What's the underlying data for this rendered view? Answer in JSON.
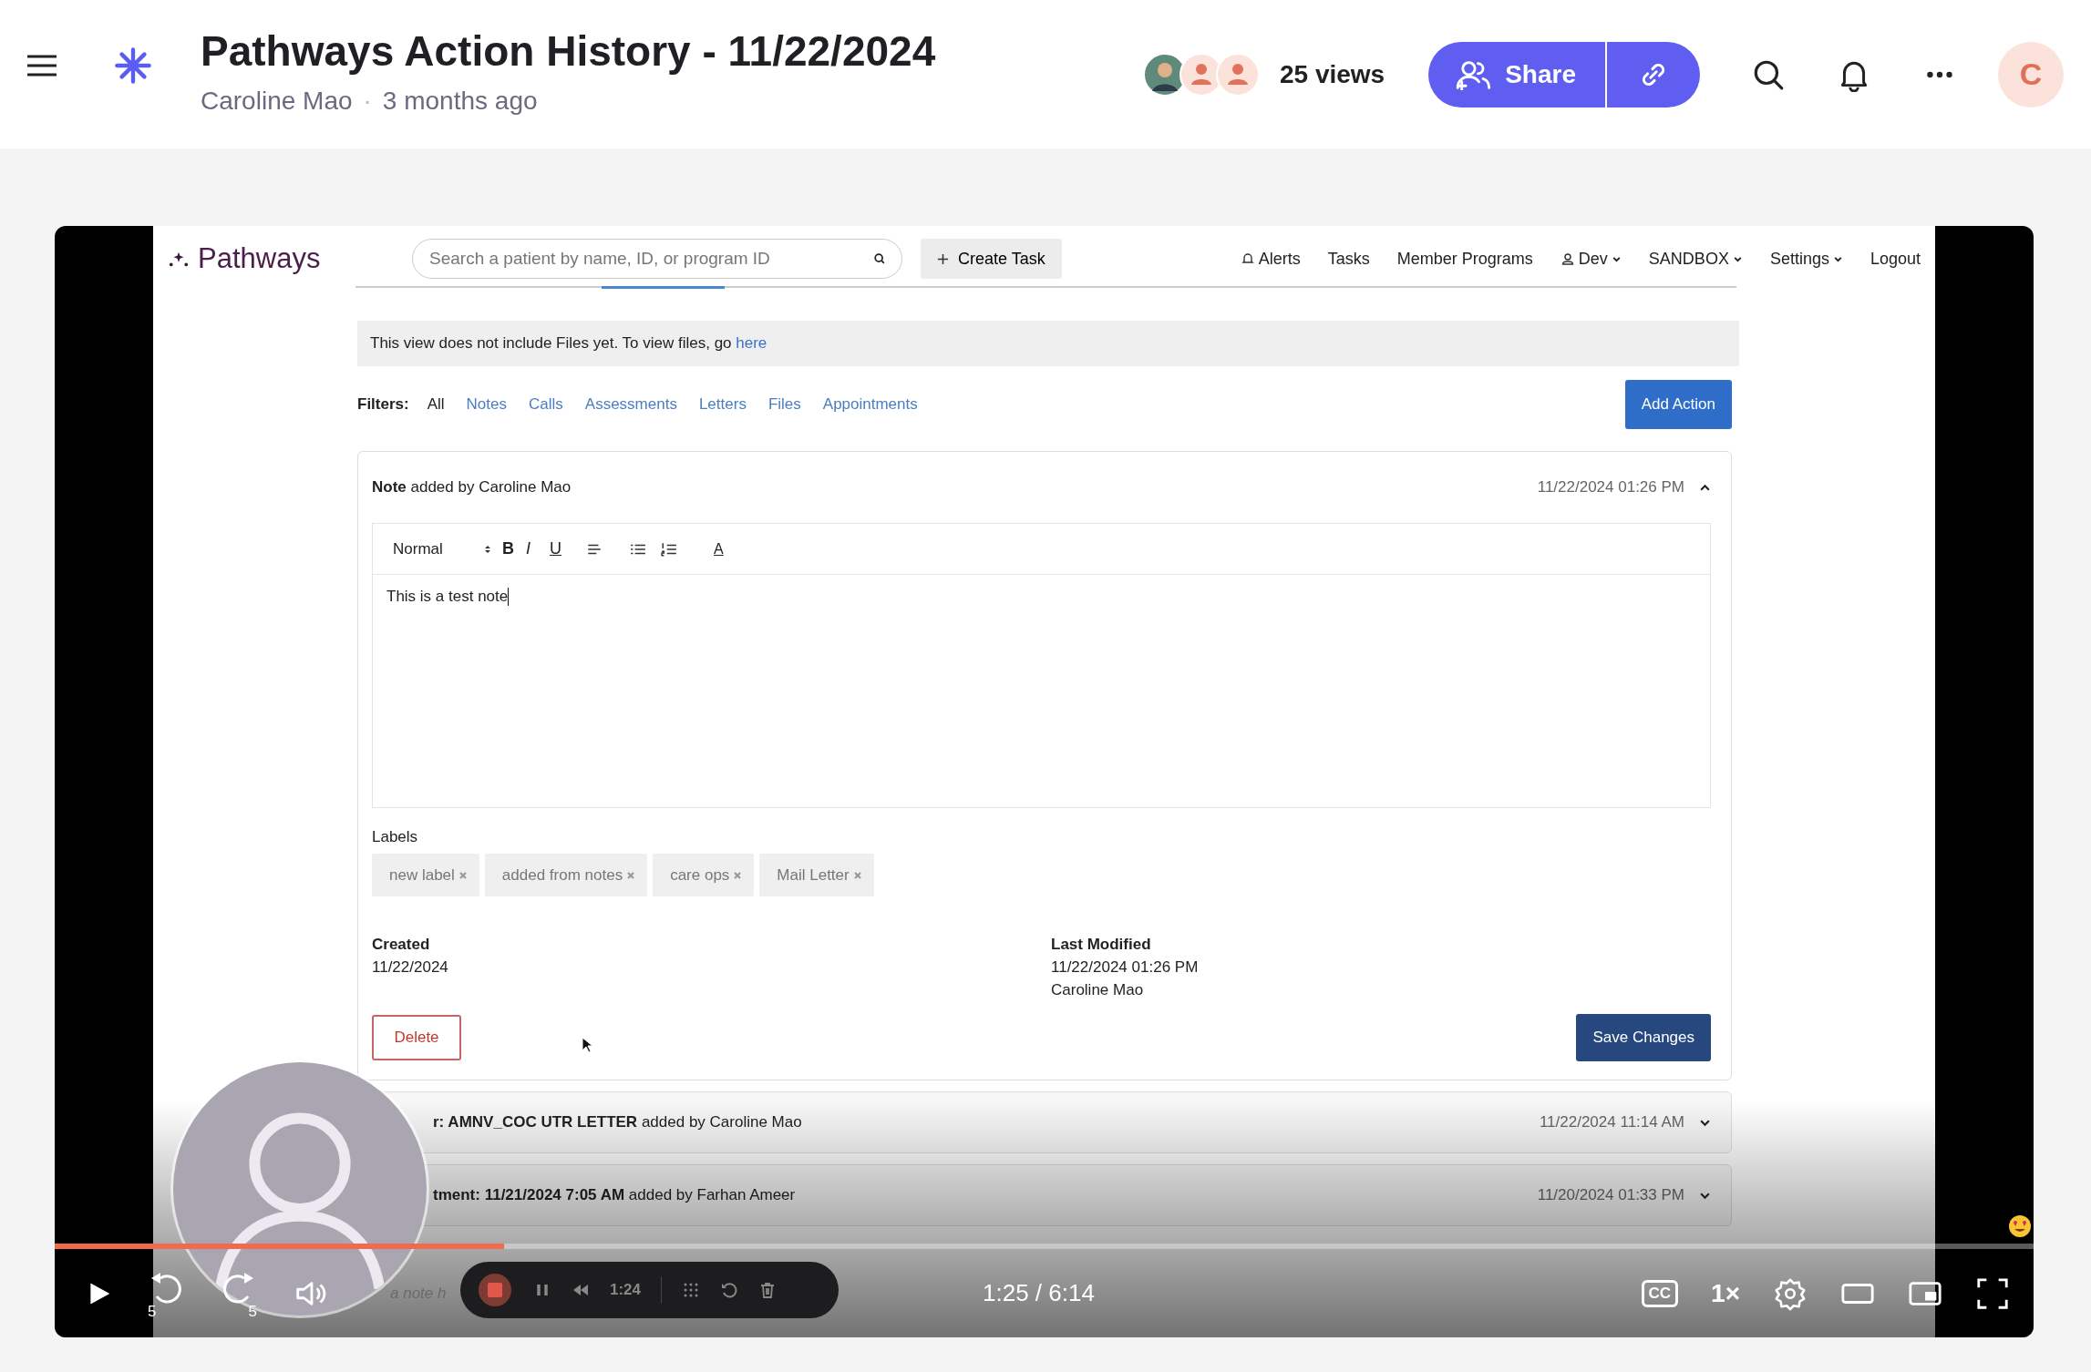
{
  "header": {
    "title": "Pathways Action History - 11/22/2024",
    "author": "Caroline Mao",
    "separator": "·",
    "time_ago": "3 months ago",
    "views": "25 views",
    "share": "Share",
    "user_initial": "C"
  },
  "video": {
    "app": {
      "logo": "Pathways",
      "search": {
        "placeholder": "Search a patient by name, ID, or program ID"
      },
      "create_task": "Create Task",
      "nav": [
        {
          "label": "Alerts",
          "kind": "bell"
        },
        {
          "label": "Tasks",
          "kind": "plain"
        },
        {
          "label": "Member Programs",
          "kind": "plain"
        },
        {
          "label": "Dev",
          "kind": "user"
        },
        {
          "label": "SANDBOX",
          "kind": "dropdown"
        },
        {
          "label": "Settings",
          "kind": "dropdown"
        },
        {
          "label": "Logout",
          "kind": "plain"
        }
      ],
      "banner": {
        "text": "This view does not include Files yet. To view files, go",
        "link": "here"
      },
      "filters": {
        "label": "Filters:",
        "items": [
          {
            "label": "All",
            "selected": true
          },
          {
            "label": "Notes",
            "selected": false
          },
          {
            "label": "Calls",
            "selected": false
          },
          {
            "label": "Assessments",
            "selected": false
          },
          {
            "label": "Letters",
            "selected": false
          },
          {
            "label": "Files",
            "selected": false
          },
          {
            "label": "Appointments",
            "selected": false
          }
        ]
      },
      "add_action": "Add Action",
      "actions": [
        {
          "title": "**Note** added by Caroline Mao",
          "timestamp": "11/22/2024 01:26 PM",
          "expanded": true,
          "editor": {
            "format": "Normal",
            "marks": [
              "B",
              "I",
              "U"
            ],
            "color_button": "A",
            "body": "This is a test note"
          },
          "labels_title": "Labels",
          "labels": [
            "new label",
            "added from notes",
            "care ops",
            "Mail Letter"
          ],
          "created": {
            "label": "Created",
            "value": "11/22/2024"
          },
          "modified": {
            "label": "Last Modified",
            "date": "11/22/2024 01:26 PM",
            "by": "Caroline Mao"
          },
          "delete": "Delete",
          "save": "Save Changes"
        },
        {
          "title": "**r: AMNV_COC UTR LETTER** added by Caroline Mao",
          "timestamp": "11/22/2024 11:14 AM",
          "expanded": false
        },
        {
          "title": "**tment: 11/21/2024 7:05 AM** added by Farhan Ameer",
          "timestamp": "11/20/2024 01:33 PM",
          "expanded": false
        }
      ],
      "faint_text": "a note h"
    },
    "recorder": {
      "timer": "1:24"
    },
    "player": {
      "level": 0.227,
      "skip_back": "5",
      "skip_forward": "5",
      "time": "1:25 / 6:14",
      "cc": "CC",
      "speed": "1×"
    }
  }
}
